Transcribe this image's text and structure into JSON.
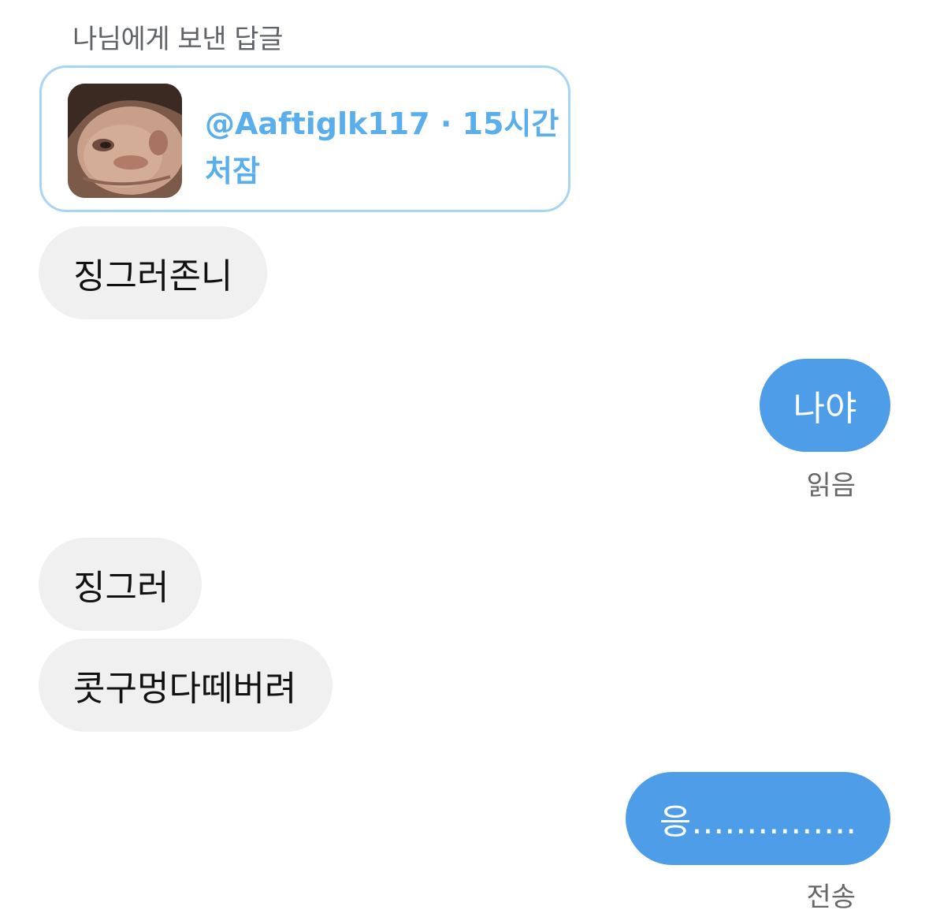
{
  "reply_header": "나님에게 보낸 답글",
  "quoted_post": {
    "handle": "@Aaftiglk117",
    "separator": " · ",
    "time": "15시간",
    "text": "처잠",
    "thumbnail": "profile-photo"
  },
  "messages": [
    {
      "direction": "incoming",
      "text": "징그러존니"
    },
    {
      "direction": "outgoing",
      "text": "나야",
      "status": "읽음"
    },
    {
      "direction": "incoming",
      "text": "징그러"
    },
    {
      "direction": "incoming",
      "text": "콧구멍다떼버려"
    },
    {
      "direction": "outgoing",
      "text": "응...............",
      "status": "전송"
    }
  ],
  "colors": {
    "incoming_bubble": "#f0f0f0",
    "outgoing_bubble": "#4d9de8",
    "quote_border": "#a9d4f3",
    "quote_text": "#5aaeec"
  }
}
